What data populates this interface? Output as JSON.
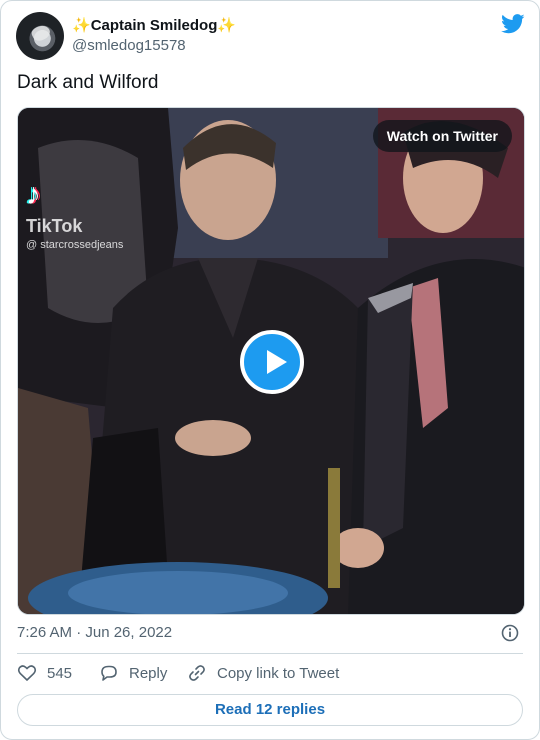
{
  "author": {
    "display_name": "Captain Smiledog",
    "sparkle": "✨",
    "handle": "@smledog15578",
    "avatar_icon": "avatar-mask-icon"
  },
  "tweet": {
    "text": "Dark and Wilford"
  },
  "media": {
    "watch_label": "Watch on Twitter",
    "play_icon": "play-icon",
    "watermark": {
      "logo": "♪",
      "word": "TikTok",
      "user": "@ starcrossedjeans"
    }
  },
  "meta": {
    "timestamp": "7:26 AM · Jun 26, 2022"
  },
  "actions": {
    "likes": "545",
    "reply": "Reply",
    "copy": "Copy link to Tweet"
  },
  "read_replies": "Read 12 replies",
  "colors": {
    "accent": "#1d9bf0",
    "link": "#1d6fb8",
    "muted": "#536471",
    "border": "#cfd9de"
  }
}
